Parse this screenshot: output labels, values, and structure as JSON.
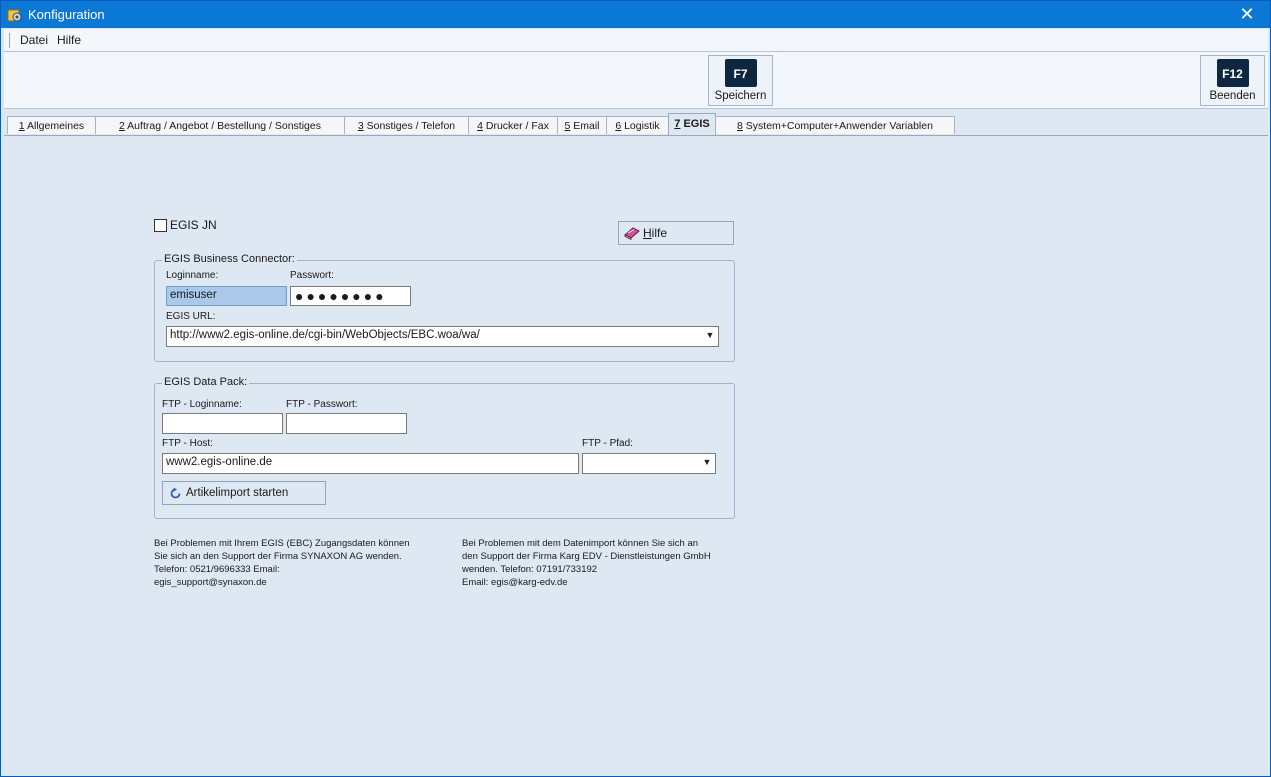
{
  "window": {
    "title": "Konfiguration",
    "close_glyph": "✕"
  },
  "menu": {
    "items": [
      "Datei",
      "Hilfe"
    ]
  },
  "toolbar": {
    "save": {
      "key": "F7",
      "label": "Speichern"
    },
    "exit": {
      "key": "F12",
      "label": "Beenden"
    }
  },
  "tabs": [
    {
      "num": "1",
      "label": " Allgemeines"
    },
    {
      "num": "2",
      "label": " Auftrag / Angebot / Bestellung / Sonstiges"
    },
    {
      "num": "3",
      "label": " Sonstiges / Telefon"
    },
    {
      "num": "4",
      "label": " Drucker / Fax"
    },
    {
      "num": "5",
      "label": " Email"
    },
    {
      "num": "6",
      "label": " Logistik"
    },
    {
      "num": "7",
      "label": " EGIS"
    },
    {
      "num": "8",
      "label": " System+Computer+Anwender Variablen"
    }
  ],
  "egis": {
    "checkbox_label": "EGIS JN",
    "help_button": {
      "accel": "H",
      "rest": "ilfe"
    },
    "connector": {
      "legend": "EGIS Business Connector:",
      "login_label": "Loginname:",
      "login_value": "emisuser",
      "password_label": "Passwort:",
      "password_dots": "●●●●●●●●",
      "url_label": "EGIS URL:",
      "url_value": "http://www2.egis-online.de/cgi-bin/WebObjects/EBC.woa/wa/"
    },
    "datapack": {
      "legend": "EGIS Data Pack:",
      "ftp_login_label": "FTP - Loginname:",
      "ftp_login_value": "",
      "ftp_password_label": "FTP - Passwort:",
      "ftp_password_value": "",
      "ftp_host_label": "FTP - Host:",
      "ftp_host_value": "www2.egis-online.de",
      "ftp_path_label": "FTP - Pfad:",
      "ftp_path_value": "",
      "import_button": "Artikelimport starten"
    },
    "notes": {
      "synaxon": "Bei Problemen mit Ihrem EGIS (EBC) Zugangsdaten können\nSie sich an den Support der Firma SYNAXON AG wenden.\nTelefon: 0521/9696333                                       Email:\negis_support@synaxon.de",
      "karg": "Bei Problemen mit dem Datenimport können Sie sich an\nden Support der Firma Karg EDV - Dienstleistungen GmbH\nwenden.          Telefon: 07191/733192\nEmail: egis@karg-edv.de"
    }
  },
  "colors": {
    "titlebar": "#0c78d6",
    "background": "#dde8f3",
    "key_badge": "#0e2741"
  }
}
